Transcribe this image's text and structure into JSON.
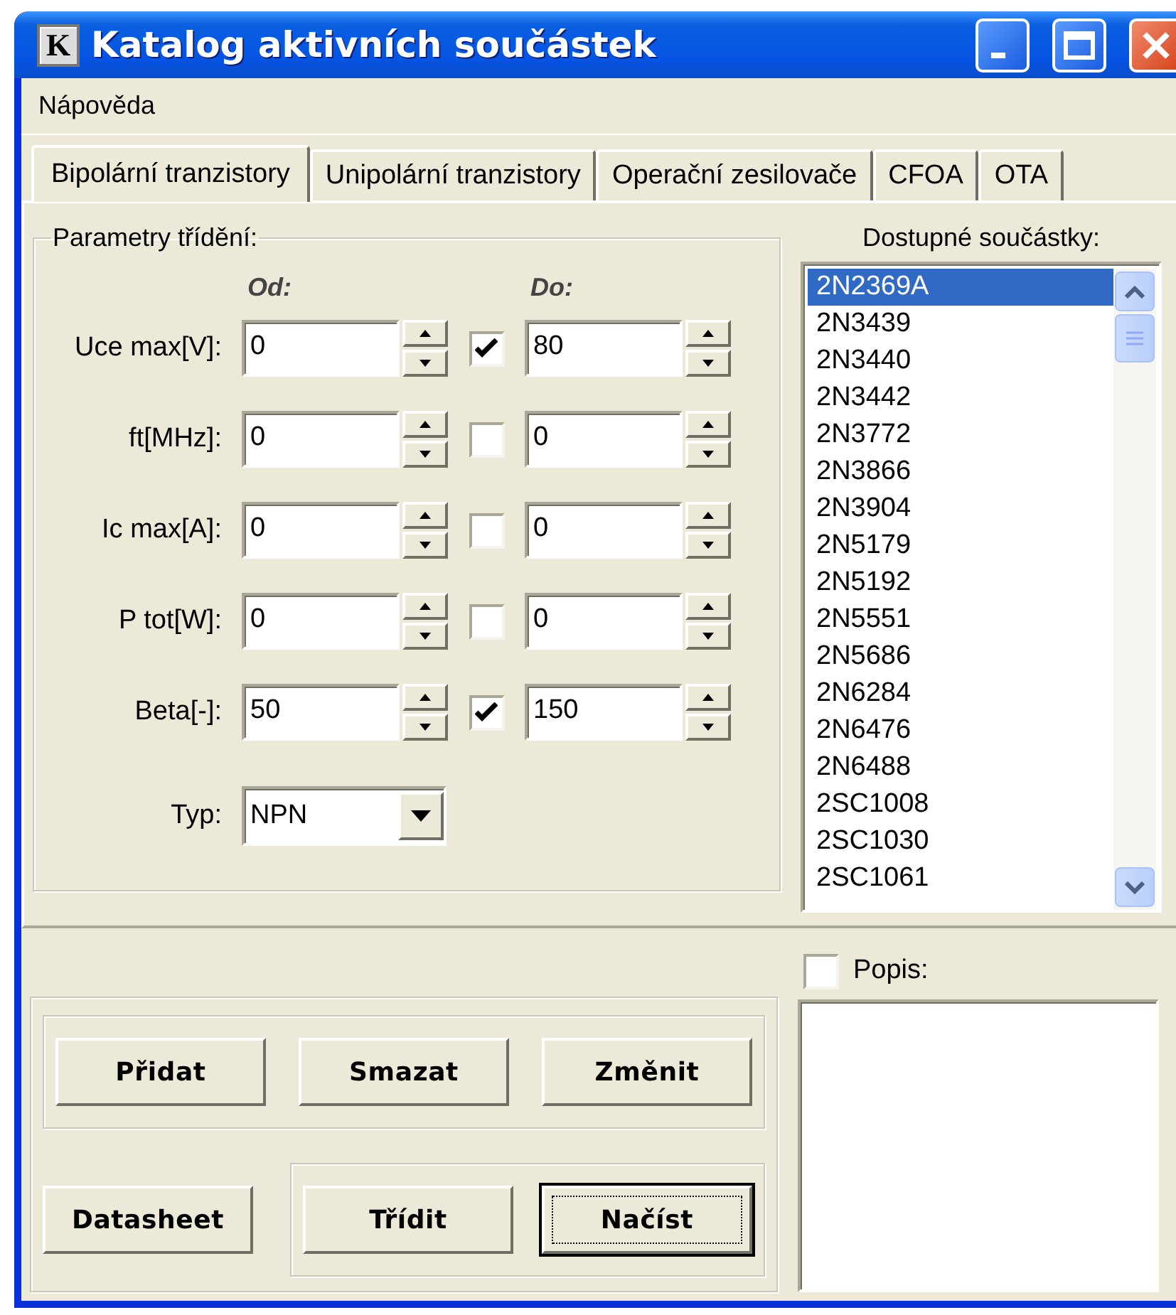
{
  "window": {
    "title": "Katalog aktivních součástek",
    "icon_text": "K"
  },
  "menu": [
    {
      "label": "Nápověda"
    }
  ],
  "tabs": [
    {
      "label": "Bipolární tranzistory",
      "selected": true
    },
    {
      "label": "Unipolární tranzistory",
      "selected": false
    },
    {
      "label": "Operační zesilovače",
      "selected": false
    },
    {
      "label": "CFOA",
      "selected": false
    },
    {
      "label": "OTA",
      "selected": false
    }
  ],
  "filter_group": {
    "title": "Parametry třídění:",
    "from_header": "Od:",
    "to_header": "Do:",
    "rows": [
      {
        "label": "Uce max[V]:",
        "from": "0",
        "enabled": true,
        "to": "80"
      },
      {
        "label": "ft[MHz]:",
        "from": "0",
        "enabled": false,
        "to": "0"
      },
      {
        "label": "Ic max[A]:",
        "from": "0",
        "enabled": false,
        "to": "0"
      },
      {
        "label": "P tot[W]:",
        "from": "0",
        "enabled": false,
        "to": "0"
      },
      {
        "label": "Beta[-]:",
        "from": "50",
        "enabled": true,
        "to": "150"
      }
    ],
    "type": {
      "label": "Typ:",
      "value": "NPN"
    }
  },
  "parts_list": {
    "label": "Dostupné součástky:",
    "items": [
      {
        "text": "2N2369A",
        "selected": true
      },
      {
        "text": "2N3439",
        "selected": false
      },
      {
        "text": "2N3440",
        "selected": false
      },
      {
        "text": "2N3442",
        "selected": false
      },
      {
        "text": "2N3772",
        "selected": false
      },
      {
        "text": "2N3866",
        "selected": false
      },
      {
        "text": "2N3904",
        "selected": false
      },
      {
        "text": "2N5179",
        "selected": false
      },
      {
        "text": "2N5192",
        "selected": false
      },
      {
        "text": "2N5551",
        "selected": false
      },
      {
        "text": "2N5686",
        "selected": false
      },
      {
        "text": "2N6284",
        "selected": false
      },
      {
        "text": "2N6476",
        "selected": false
      },
      {
        "text": "2N6488",
        "selected": false
      },
      {
        "text": "2SC1008",
        "selected": false
      },
      {
        "text": "2SC1030",
        "selected": false
      },
      {
        "text": "2SC1061",
        "selected": false
      }
    ]
  },
  "description": {
    "label": "Popis:",
    "checked": false
  },
  "edit_buttons": [
    {
      "label": "Přidat",
      "default": false
    },
    {
      "label": "Smazat",
      "default": false
    },
    {
      "label": "Změnit",
      "default": false
    }
  ],
  "datasheet_button": {
    "label": "Datasheet",
    "default": false
  },
  "sort_buttons": [
    {
      "label": "Třídit",
      "default": false
    },
    {
      "label": "Načíst",
      "default": true
    }
  ]
}
